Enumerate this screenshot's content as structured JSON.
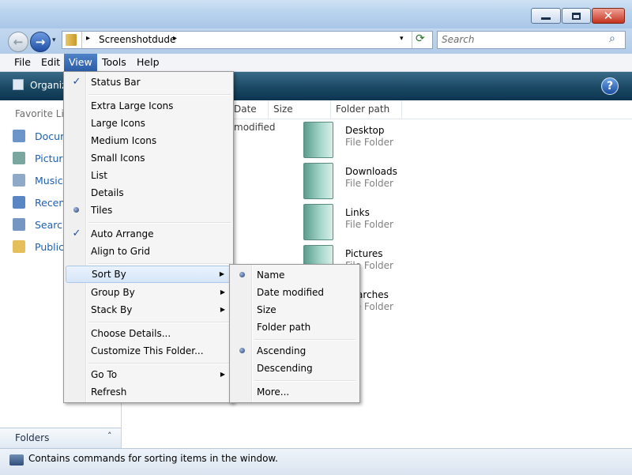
{
  "window": {
    "close_glyph": "✕"
  },
  "nav": {
    "back_glyph": "←",
    "forward_glyph": "→",
    "history_glyph": "▾"
  },
  "address": {
    "chevron": "▸",
    "crumb": "Screenshotdude",
    "drop_glyph": "▾",
    "refresh_glyph": "⟳"
  },
  "search": {
    "placeholder": "Search",
    "icon_glyph": "⌕"
  },
  "menubar": {
    "items": [
      "File",
      "Edit",
      "View",
      "Tools",
      "Help"
    ],
    "active": "View"
  },
  "toolbar": {
    "organize_label": "Organize",
    "help_glyph": "?"
  },
  "navpane": {
    "heading": "Favorite Links",
    "items": [
      {
        "label": "Documents",
        "icon": "documents-icon",
        "color": "#6c95c9"
      },
      {
        "label": "Pictures",
        "icon": "pictures-icon",
        "color": "#7aa6a0"
      },
      {
        "label": "Music",
        "icon": "music-icon",
        "color": "#8fa9c8"
      },
      {
        "label": "Recently Changed",
        "icon": "recent-icon",
        "color": "#5b86c4"
      },
      {
        "label": "Searches",
        "icon": "searches-icon",
        "color": "#7596c2"
      },
      {
        "label": "Public",
        "icon": "public-folder-icon",
        "color": "#e4bf5a"
      }
    ],
    "folders_label": "Folders",
    "folders_chevron": "˄"
  },
  "columns": [
    "Date modified",
    "Size",
    "Folder path"
  ],
  "files": [
    {
      "name": "Desktop",
      "type": "File Folder"
    },
    {
      "name": "Downloads",
      "type": "File Folder"
    },
    {
      "name": "Links",
      "type": "File Folder"
    },
    {
      "name": "Pictures",
      "type": "File Folder"
    },
    {
      "name": "Searches",
      "type": "File Folder"
    }
  ],
  "view_menu": {
    "status_bar": "Status Bar",
    "extra_large_icons": "Extra Large Icons",
    "large_icons": "Large Icons",
    "medium_icons": "Medium Icons",
    "small_icons": "Small Icons",
    "list": "List",
    "details": "Details",
    "tiles": "Tiles",
    "auto_arrange": "Auto Arrange",
    "align_to_grid": "Align to Grid",
    "sort_by": "Sort By",
    "group_by": "Group By",
    "stack_by": "Stack By",
    "choose_details": "Choose Details...",
    "customize_folder": "Customize This Folder...",
    "go_to": "Go To",
    "refresh": "Refresh",
    "check_glyph": "✓",
    "submenu_glyph": "▶"
  },
  "sort_menu": {
    "name": "Name",
    "date_modified": "Date modified",
    "size": "Size",
    "folder_path": "Folder path",
    "ascending": "Ascending",
    "descending": "Descending",
    "more": "More..."
  },
  "statusbar": {
    "text": "Contains commands for sorting items in the window."
  }
}
